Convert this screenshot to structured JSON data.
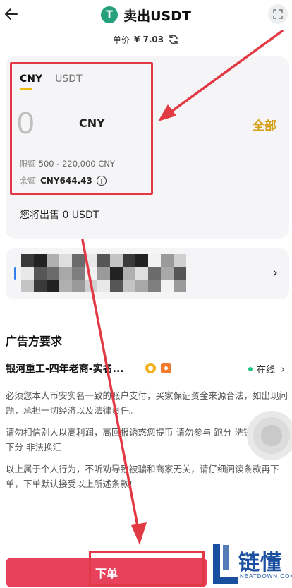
{
  "header": {
    "title": "卖出USDT",
    "logo_letter": "T"
  },
  "price": {
    "label": "单价",
    "value": "¥ 7.03"
  },
  "amount_card": {
    "tabs": [
      {
        "label": "CNY",
        "active": true
      },
      {
        "label": "USDT",
        "active": false
      }
    ],
    "amount": "0",
    "unit": "CNY",
    "all_label": "全部",
    "limit_label": "限额",
    "limit_value": "500 - 220,000 CNY",
    "balance_label": "余额",
    "balance_value": "CNY644.43",
    "sell_label": "您将出售",
    "sell_value": "0 USDT"
  },
  "advertiser": {
    "section_title": "广告方要求",
    "merchant_name": "银河重工-四年老商-实名...",
    "status": "在线",
    "paragraphs": [
      "必须您本人币安实名一致的账户支付，买家保证资金来源合法，如出现问题，承担一切经济以及法律责任。",
      "请勿相信别人以高利润，高回报诱惑您提币 请勿参与 跑分 洗钱 赌博 上下分 非法换汇",
      "以上属于个人行为，不听劝导致被骗和商家无关，请仔细阅读条款再下单，下单默认接受以上所述条款!"
    ]
  },
  "bottom": {
    "order_label": "下单"
  },
  "watermark": {
    "brand": "链懂",
    "domain": "NEATDOWN.COM"
  },
  "colors": {
    "accent_gold": "#f0b90b",
    "order_red": "#e8415c",
    "online_green": "#1ec783",
    "usdt_green": "#26a17b"
  }
}
